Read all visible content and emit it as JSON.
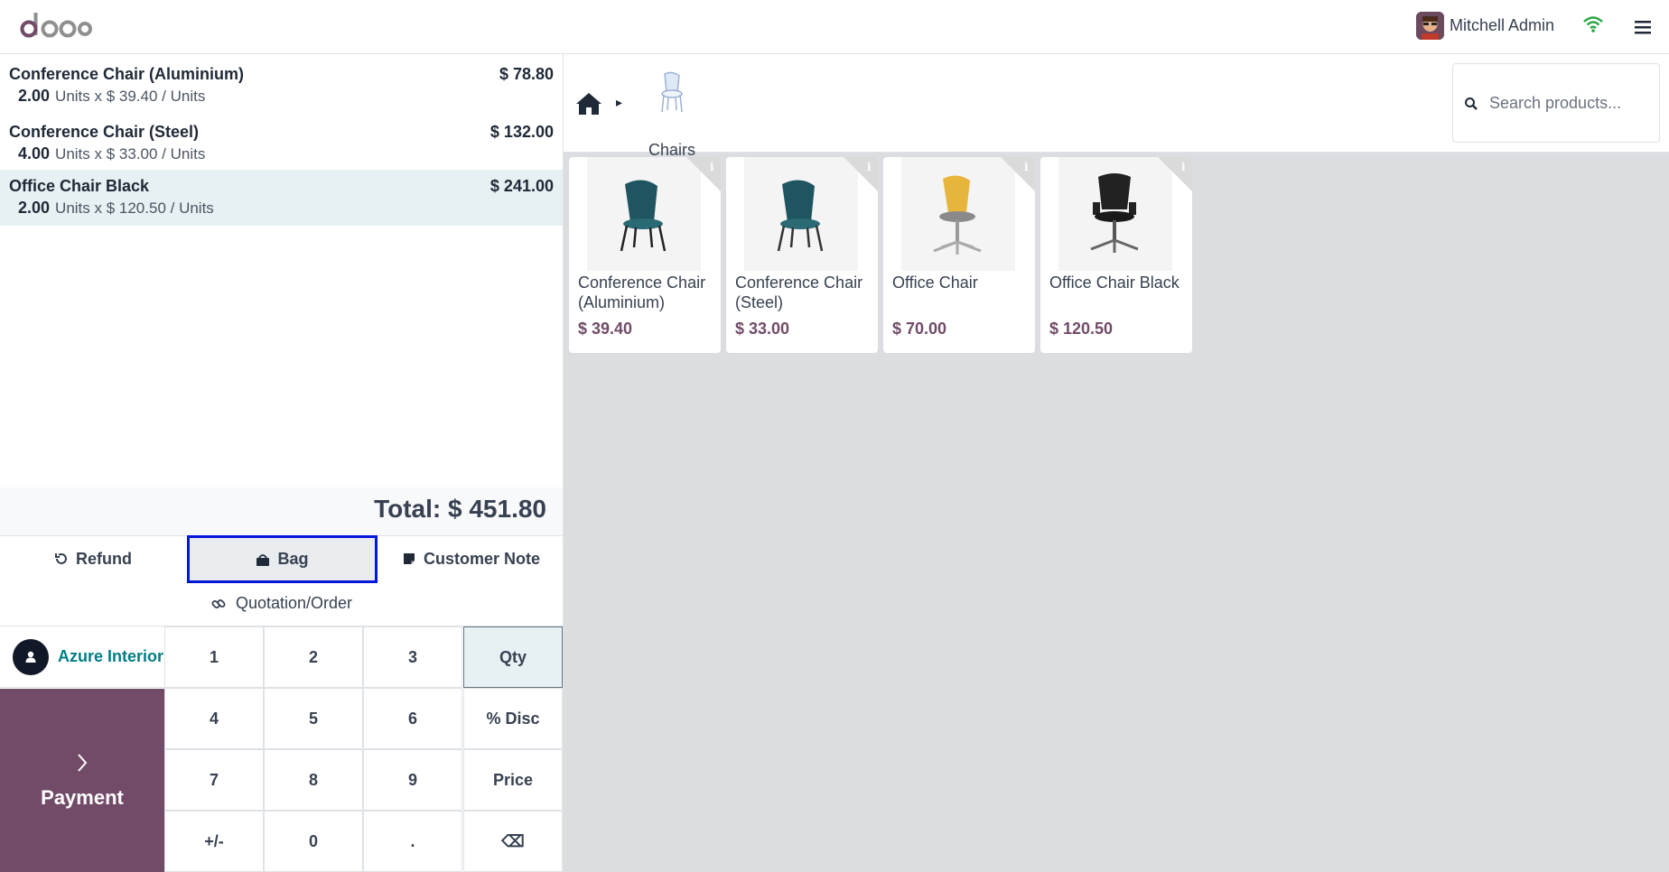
{
  "header": {
    "logo_text": "odoo",
    "user_name": "Mitchell Admin"
  },
  "order": {
    "lines": [
      {
        "name": "Conference Chair (Aluminium)",
        "qty": "2.00",
        "detail": "Units x $ 39.40 / Units",
        "price": "$ 78.80"
      },
      {
        "name": "Conference Chair (Steel)",
        "qty": "4.00",
        "detail": "Units x $ 33.00 / Units",
        "price": "$ 132.00"
      },
      {
        "name": "Office Chair Black",
        "qty": "2.00",
        "detail": "Units x $ 120.50 / Units",
        "price": "$ 241.00"
      }
    ],
    "total": "Total: $ 451.80"
  },
  "controls": {
    "refund": "Refund",
    "bag": "Bag",
    "customer_note": "Customer Note",
    "quotation": "Quotation/Order"
  },
  "customer": {
    "name": "Azure Interior"
  },
  "payment": {
    "label": "Payment"
  },
  "numpad": {
    "k1": "1",
    "k2": "2",
    "k3": "3",
    "qty": "Qty",
    "k4": "4",
    "k5": "5",
    "k6": "6",
    "disc": "% Disc",
    "k7": "7",
    "k8": "8",
    "k9": "9",
    "price": "Price",
    "sign": "+/-",
    "k0": "0",
    "dot": ".",
    "backspace": "⌫"
  },
  "catalog": {
    "category": "Chairs",
    "search_placeholder": "Search products...",
    "products": [
      {
        "name": "Conference Chair (Aluminium)",
        "price": "$ 39.40"
      },
      {
        "name": "Conference Chair (Steel)",
        "price": "$ 33.00"
      },
      {
        "name": "Office Chair",
        "price": "$ 70.00"
      },
      {
        "name": "Office Chair Black",
        "price": "$ 120.50"
      }
    ]
  },
  "colors": {
    "brand": "#714b67",
    "accent_teal": "#017e84",
    "selected_bg": "#e6f1f3",
    "highlight_border": "#0016d9"
  }
}
